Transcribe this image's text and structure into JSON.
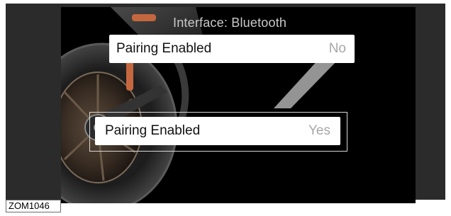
{
  "screen": {
    "title": "Interface: Bluetooth"
  },
  "settings": {
    "before": {
      "label": "Pairing Enabled",
      "value": "No"
    },
    "after": {
      "label": "Pairing Enabled",
      "value": "Yes"
    }
  },
  "figure": {
    "caption": "ZOM1046"
  },
  "colors": {
    "frame": "#2b2b2b",
    "display_bg": "#000000",
    "row_bg": "#ffffff",
    "value_text": "#a7a7a7",
    "accent_orange": "#c4673e"
  },
  "icons": {
    "background_art": "motorcycle-wheel-image",
    "callout": "callout-pointer"
  }
}
